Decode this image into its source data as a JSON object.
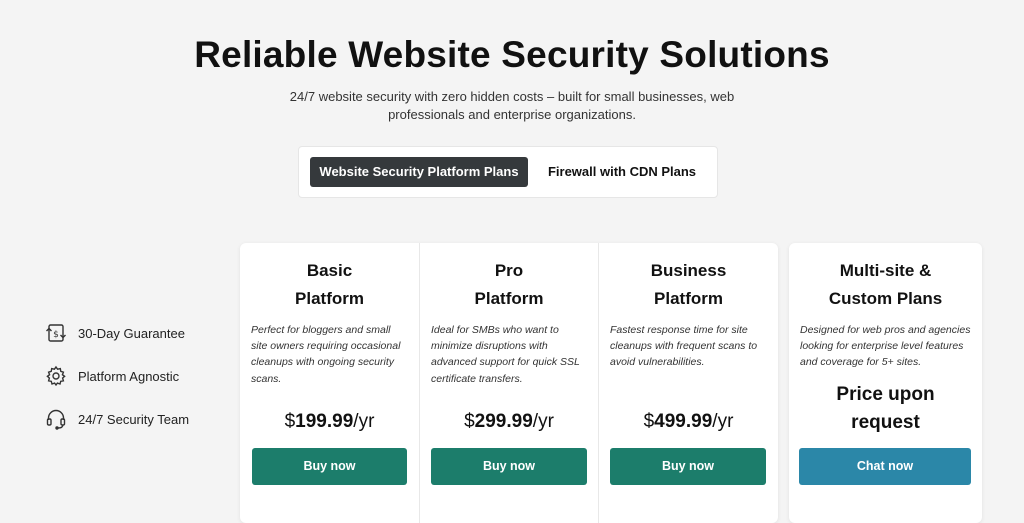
{
  "colors": {
    "buy_button": "#1c7d6b",
    "chat_button": "#2b87a8",
    "active_tab": "#35393c"
  },
  "header": {
    "title": "Reliable Website Security Solutions",
    "subtitle": "24/7 website security with zero hidden costs – built for small businesses, web professionals and enterprise organizations."
  },
  "tabs": [
    {
      "label": "Website Security Platform Plans",
      "active": true
    },
    {
      "label": "Firewall with CDN Plans",
      "active": false
    }
  ],
  "features": [
    {
      "icon": "money-back-icon",
      "label": "30-Day Guarantee"
    },
    {
      "icon": "gear-icon",
      "label": "Platform Agnostic"
    },
    {
      "icon": "headset-icon",
      "label": "24/7 Security Team"
    }
  ],
  "plans": [
    {
      "name_line1": "Basic",
      "name_line2": "Platform",
      "description": "Perfect for bloggers and small site owners requiring occasional cleanups with ongoing security scans.",
      "currency": "$",
      "amount": "199.99",
      "period": "/yr",
      "button": "Buy now"
    },
    {
      "name_line1": "Pro",
      "name_line2": "Platform",
      "description": "Ideal for SMBs who want to minimize disruptions with advanced support for quick SSL certificate transfers.",
      "currency": "$",
      "amount": "299.99",
      "period": "/yr",
      "button": "Buy now"
    },
    {
      "name_line1": "Business",
      "name_line2": "Platform",
      "description": "Fastest response time for site cleanups with frequent scans to avoid vulnerabilities.",
      "currency": "$",
      "amount": "499.99",
      "period": "/yr",
      "button": "Buy now"
    },
    {
      "name_line1": "Multi-site &",
      "name_line2": "Custom Plans",
      "description": "Designed for web pros and agencies looking for enterprise level features and coverage for 5+ sites.",
      "price_line1": "Price upon",
      "price_line2": "request",
      "button": "Chat now"
    }
  ]
}
